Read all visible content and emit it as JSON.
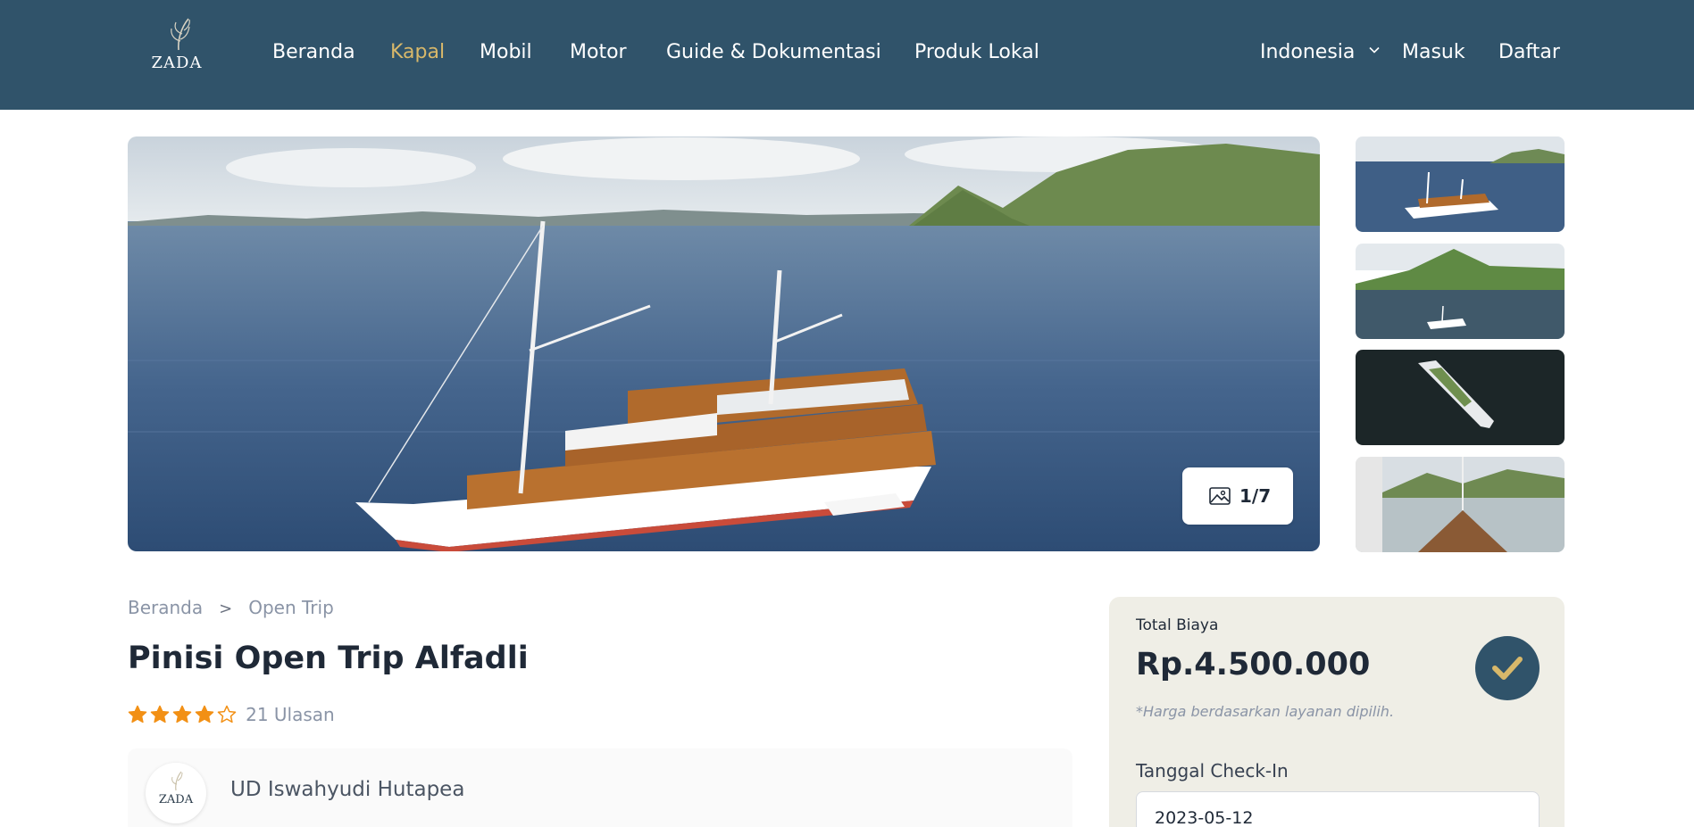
{
  "brand": {
    "logo_text": "ZADA"
  },
  "nav": {
    "items": [
      {
        "label": "Beranda",
        "active": false
      },
      {
        "label": "Kapal",
        "active": true
      },
      {
        "label": "Mobil",
        "active": false
      },
      {
        "label": "Motor",
        "active": false
      },
      {
        "label": "Guide & Dokumentasi",
        "active": false
      },
      {
        "label": "Produk Lokal",
        "active": false
      }
    ],
    "language": "Indonesia",
    "login": "Masuk",
    "register": "Daftar"
  },
  "gallery": {
    "counter": "1/7",
    "thumbnails": [
      "boat-at-sea",
      "green-island-bay",
      "aerial-boat-dark-water",
      "bow-deck-harbor"
    ]
  },
  "breadcrumb": {
    "home": "Beranda",
    "separator": ">",
    "current": "Open Trip"
  },
  "product": {
    "title": "Pinisi Open Trip Alfadli",
    "rating": 4,
    "rating_max": 5,
    "reviews": "21 Ulasan",
    "owner_logo_text": "ZADA",
    "owner_name": "UD Iswahyudi Hutapea"
  },
  "booking": {
    "total_label": "Total Biaya",
    "price": "Rp.4.500.000",
    "note": "*Harga berdasarkan layanan dipilih.",
    "checkin_label": "Tanggal Check-In",
    "checkin_value": "2023-05-12"
  },
  "colors": {
    "header": "#30536a",
    "accent": "#d8b86a",
    "star": "#f29015",
    "card": "#efeee6"
  }
}
